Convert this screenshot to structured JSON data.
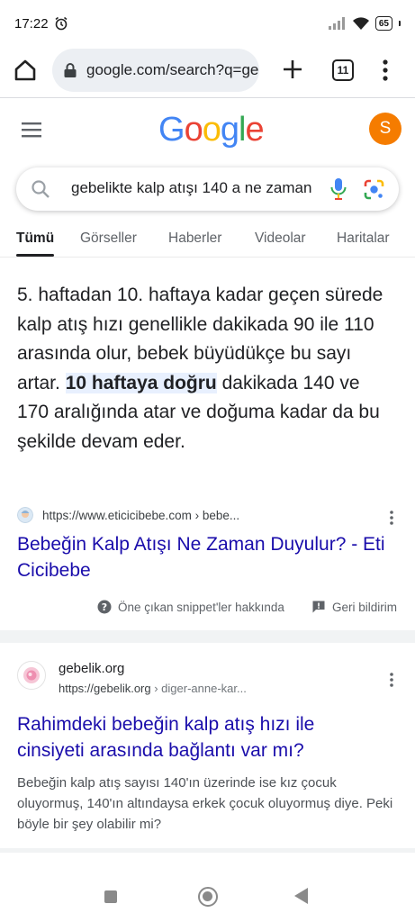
{
  "status_bar": {
    "time": "17:22",
    "battery": "65"
  },
  "browser": {
    "url": "google.com/search?q=ge",
    "tab_count": "11"
  },
  "google": {
    "logo_letters": [
      {
        "ch": "G",
        "color": "#4285F4"
      },
      {
        "ch": "o",
        "color": "#EA4335"
      },
      {
        "ch": "o",
        "color": "#FBBC05"
      },
      {
        "ch": "g",
        "color": "#4285F4"
      },
      {
        "ch": "l",
        "color": "#34A853"
      },
      {
        "ch": "e",
        "color": "#EA4335"
      }
    ],
    "avatar_letter": "S",
    "avatar_color": "#f57c00"
  },
  "search": {
    "query": "gebelikte kalp atışı 140 a ne zaman"
  },
  "tabs": [
    "Tümü",
    "Görseller",
    "Haberler",
    "Videolar",
    "Haritalar"
  ],
  "active_tab": "Tümü",
  "featured": {
    "text_before": "5. haftadan 10. haftaya kadar geçen sürede kalp atış hızı genellikle dakikada 90 ile 110 arasında olur, bebek büyüdükçe bu sayı artar. ",
    "highlight": "10 haftaya doğru",
    "text_after": " dakikada 140 ve 170 aralığında atar ve doğuma kadar da bu şekilde devam eder.",
    "source_url": "https://www.eticicibebe.com › bebe...",
    "title": "Bebeğin Kalp Atışı Ne Zaman Duyulur? - Eti Cicibebe",
    "footer_about": "Öne çıkan snippet'ler hakkında",
    "footer_feedback": "Geri bildirim"
  },
  "result2": {
    "site": "gebelik.org",
    "url": "https://gebelik.org",
    "breadcrumb": " › diger-anne-kar...",
    "title": "Rahimdeki bebeğin kalp atış hızı ile cinsiyeti arasında bağlantı var mı?",
    "description": "Bebeğin kalp atış sayısı 140'ın üzerinde ise kız çocuk oluyormuş, 140'ın altındaysa erkek çocuk oluyormuş diye. Peki böyle bir şey olabilir mi?"
  },
  "colors": {
    "link": "#1a0dab",
    "highlight_bg": "#e8f0fe",
    "accent": "#4285F4"
  }
}
